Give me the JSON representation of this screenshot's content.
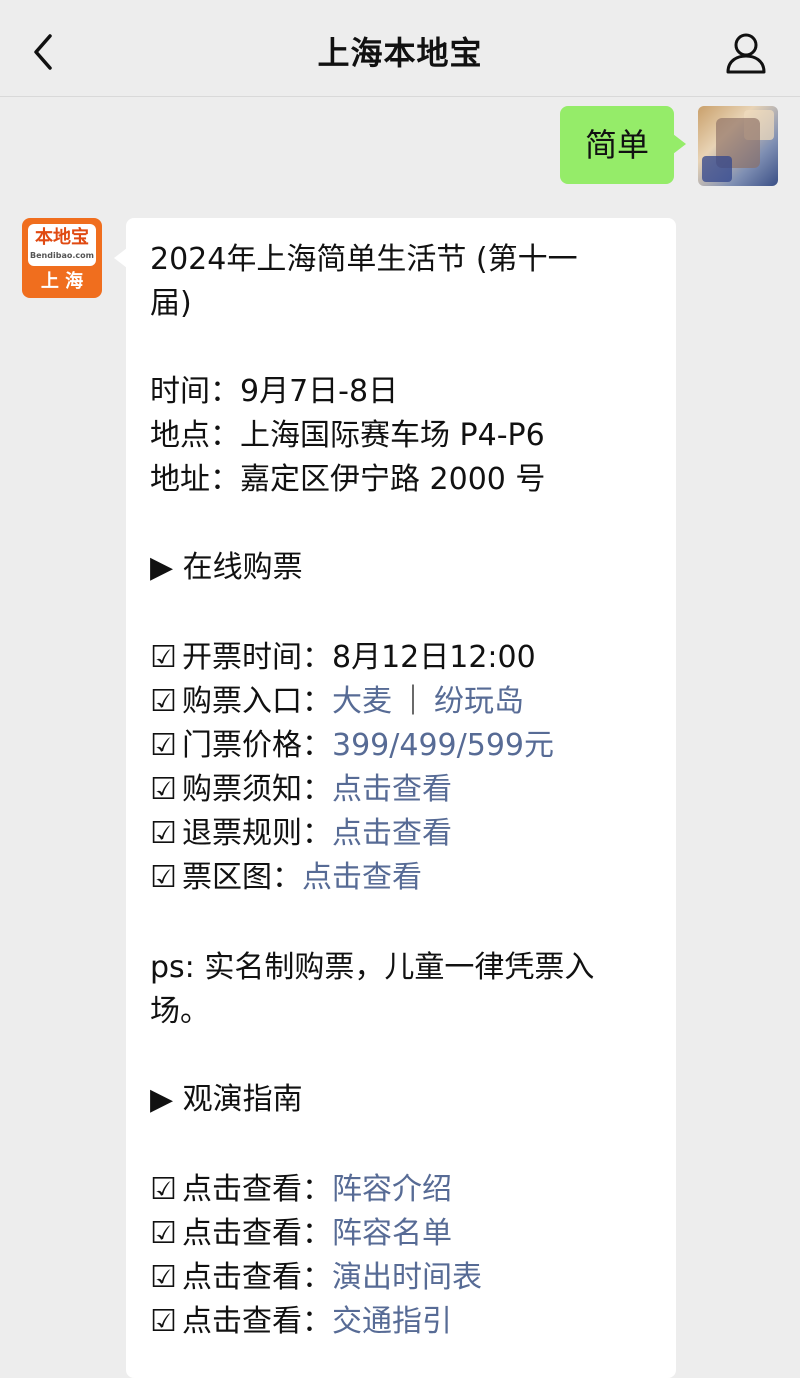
{
  "header": {
    "title": "上海本地宝"
  },
  "outgoing": {
    "text": "简单"
  },
  "bot_avatar": {
    "logo": "本地宝",
    "domain": "Bendibao.com",
    "city": "上 海"
  },
  "message": {
    "title_line1": "2024年上海简单生活节 (第十一",
    "title_line2": "届)",
    "time": "时间：9月7日-8日",
    "place": "地点：上海国际赛车场 P4-P6",
    "address": "地址：嘉定区伊宁路 2000 号",
    "section_buy": "▶ 在线购票",
    "check": "☑",
    "open_time": "开票时间：8月12日12:00",
    "entry_label": "购票入口：",
    "entry_link1": "大麦",
    "entry_sep": "｜",
    "entry_link2": "纷玩岛",
    "price_label": "门票价格：",
    "price_value": "399/499/599元",
    "notice_label": "购票须知：",
    "refund_label": "退票规则：",
    "map_label": "票区图：",
    "view_link": "点击查看",
    "ps_line1": "ps: 实名制购票，儿童一律凭票入",
    "ps_line2": "场。",
    "section_guide": "▶ 观演指南",
    "guide_label": "点击查看：",
    "guide_links": [
      "阵容介绍",
      "阵容名单",
      "演出时间表",
      "交通指引"
    ]
  }
}
